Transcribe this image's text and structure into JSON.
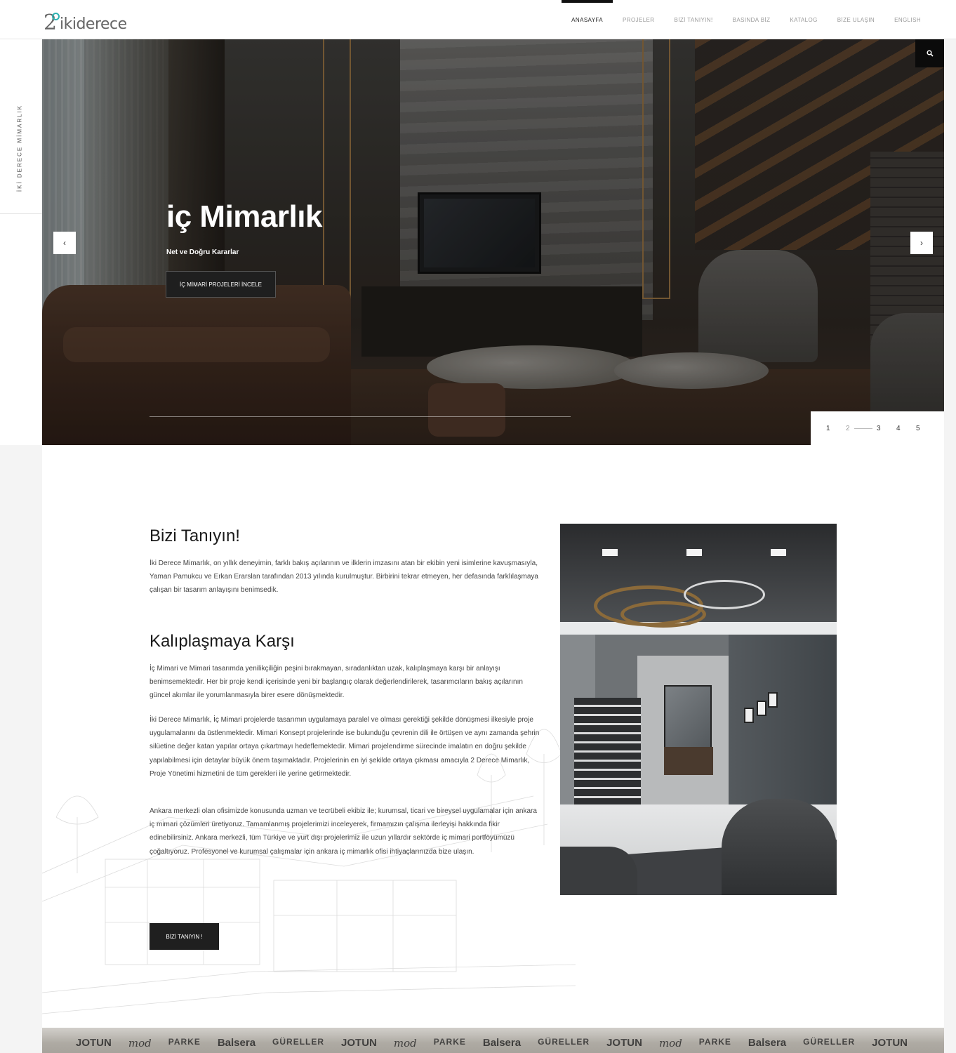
{
  "header": {
    "logo": {
      "mark": "2",
      "text": "ikiderece"
    },
    "nav": [
      {
        "label": "ANASAYFA",
        "active": true
      },
      {
        "label": "PROJELER",
        "active": false
      },
      {
        "label": "BİZİ TANIYIN!",
        "active": false
      },
      {
        "label": "BASINDA BİZ",
        "active": false
      },
      {
        "label": "KATALOG",
        "active": false
      },
      {
        "label": "BİZE ULAŞIN",
        "active": false
      },
      {
        "label": "ENGLISH",
        "active": false
      }
    ]
  },
  "side": {
    "tagline": "İKİ DERECE MİMARLIK"
  },
  "hero": {
    "title": "iç Mimarlık",
    "subtitle": "Net ve Doğru Kararlar",
    "button": "İÇ MİMARİ PROJELERİ İNCELE",
    "prev_icon": "chevron-left-icon",
    "next_icon": "chevron-right-icon",
    "search_icon": "search-icon",
    "prev_glyph": "‹",
    "next_glyph": "›",
    "pagination": [
      "1",
      "2",
      "3",
      "4",
      "5"
    ],
    "active_slide": 2
  },
  "about": {
    "heading1": "Bizi Tanıyın!",
    "p1": "İki Derece Mimarlık, on yıllık deneyimin, farklı bakış açılarının ve ilklerin imzasını atan bir ekibin yeni isimlerine kavuşmasıyla, Yaman Pamukcu ve Erkan Erarslan tarafından 2013 yılında kurulmuştur. Birbirini tekrar etmeyen, her defasında farklılaşmaya çalışan bir tasarım anlayışını benimsedik.",
    "heading2": "Kalıplaşmaya Karşı",
    "p2": "İç Mimari ve Mimari tasarımda yenilikçiliğin peşini bırakmayan, sıradanlıktan uzak, kalıplaşmaya karşı bir anlayışı benimsemektedir. Her bir proje kendi içerisinde yeni bir başlangıç olarak değerlendirilerek, tasarımcıların bakış açılarının güncel akımlar ile yorumlanmasıyla birer esere dönüşmektedir.",
    "p3": "İki Derece Mimarlık, İç Mimari projelerde tasarımın uygulamaya paralel ve olması gerektiği şekilde dönüşmesi ilkesiyle proje uygulamalarını da üstlenmektedir. Mimari Konsept projelerinde ise bulunduğu çevrenin dili ile örtüşen ve aynı zamanda şehrin silüetine değer katan yapılar ortaya çıkartmayı hedeflemektedir. Mimari projelendirme sürecinde imalatın en doğru şekilde yapılabilmesi için detaylar büyük önem taşımaktadır. Projelerinin en iyi şekilde ortaya çıkması amacıyla 2 Derece Mimarlık, Proje Yönetimi hizmetini de tüm gerekleri ile yerine getirmektedir.",
    "p4": "Ankara merkezli olan ofisimizde konusunda uzman ve tecrübeli ekibiz ile; kurumsal, ticari ve bireysel uygulamalar için ankara iç mimari çözümleri üretiyoruz. Tamamlanmış projelerimizi inceleyerek, firmamızın çalışma ilerleyişi hakkında fikir edinebilirsiniz. Ankara merkezli, tüm Türkiye ve yurt dışı projelerimiz ile uzun yıllardır sektörde iç mimari portföyümüzü çoğaltıyoruz. Profesyonel ve kurumsal çalışmalar için ankara iç mimarlık ofisi ihtiyaçlarınızda bize ulaşın.",
    "button": "BİZİ TANIYIN !"
  },
  "brands": [
    {
      "name": "JOTUN",
      "style": "bold"
    },
    {
      "name": "mod",
      "style": "script"
    },
    {
      "name": "PARKE",
      "style": "small"
    },
    {
      "name": "Balsera",
      "style": "bold"
    },
    {
      "name": "GÜRELLER",
      "style": "small"
    },
    {
      "name": "JOTUN",
      "style": "bold"
    },
    {
      "name": "mod",
      "style": "script"
    },
    {
      "name": "PARKE",
      "style": "small"
    },
    {
      "name": "Balsera",
      "style": "bold"
    },
    {
      "name": "GÜRELLER",
      "style": "small"
    },
    {
      "name": "JOTUN",
      "style": "bold"
    },
    {
      "name": "mod",
      "style": "script"
    },
    {
      "name": "PARKE",
      "style": "small"
    },
    {
      "name": "Balsera",
      "style": "bold"
    },
    {
      "name": "GÜRELLER",
      "style": "small"
    },
    {
      "name": "JOTUN",
      "style": "bold"
    }
  ],
  "colors": {
    "accent": "#2fb4b4",
    "dark": "#1f1f1f"
  }
}
